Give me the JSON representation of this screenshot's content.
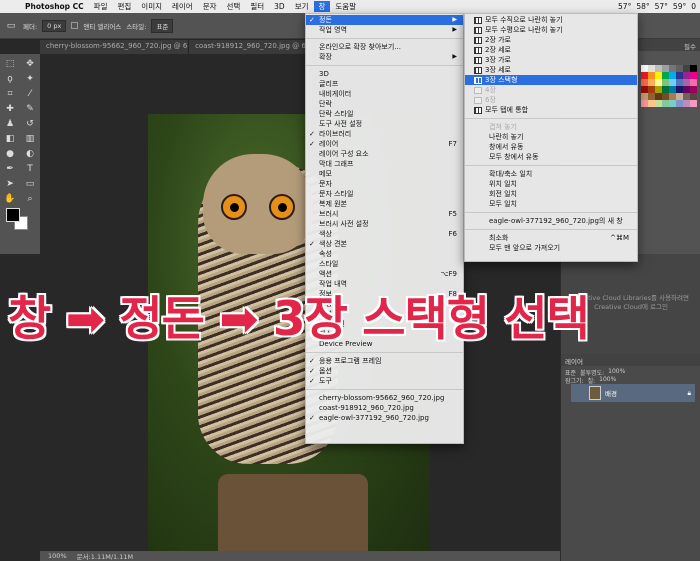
{
  "menubar": {
    "app": "Photoshop CC",
    "items": [
      "파일",
      "편집",
      "이미지",
      "레이어",
      "문자",
      "선택",
      "필터",
      "3D",
      "보기",
      "창",
      "도움말"
    ],
    "status": [
      "57°",
      "58°",
      "57°",
      "59°",
      "0"
    ]
  },
  "optbar": {
    "feather_label": "페더:",
    "feather_value": "0 px",
    "antialias": "앤티 앨리어스",
    "style_label": "스타일:",
    "style_value": "표준"
  },
  "tabs": [
    "cherry-blossom-95662_960_720.jpg @ 6...",
    "coast-918912_960_720.jpg @ 6..."
  ],
  "window_menu": {
    "items": [
      {
        "label": "정돈",
        "check": "✓",
        "submenu": true,
        "highlighted": true
      },
      {
        "label": "작업 영역",
        "submenu": true
      },
      {
        "sep": true
      },
      {
        "label": "온라인으로 확장 찾아보기..."
      },
      {
        "label": "확장",
        "submenu": true
      },
      {
        "sep": true
      },
      {
        "label": "3D"
      },
      {
        "label": "글리프"
      },
      {
        "label": "내비게이터"
      },
      {
        "label": "단락"
      },
      {
        "label": "단락 스타일"
      },
      {
        "label": "도구 사전 설정"
      },
      {
        "label": "라이브러리",
        "check": "✓"
      },
      {
        "label": "레이어",
        "check": "✓",
        "shortcut": "F7"
      },
      {
        "label": "레이어 구성 요소"
      },
      {
        "label": "막대 그래프"
      },
      {
        "label": "메모"
      },
      {
        "label": "문자"
      },
      {
        "label": "문자 스타일"
      },
      {
        "label": "복제 원본"
      },
      {
        "label": "브러시",
        "shortcut": "F5"
      },
      {
        "label": "브러시 사전 설정"
      },
      {
        "label": "색상",
        "shortcut": "F6"
      },
      {
        "label": "색상 견본",
        "check": "✓"
      },
      {
        "label": "속성"
      },
      {
        "label": "스타일"
      },
      {
        "label": "액션",
        "shortcut": "⌥F9"
      },
      {
        "label": "작업 내역"
      },
      {
        "label": "정보",
        "shortcut": "F8"
      },
      {
        "label": "조정"
      },
      {
        "label": "채널"
      },
      {
        "label": "타임라인"
      },
      {
        "label": "패스"
      },
      {
        "label": "Device Preview"
      },
      {
        "sep": true
      },
      {
        "label": "응용 프로그램 프레임",
        "check": "✓"
      },
      {
        "label": "옵션",
        "check": "✓"
      },
      {
        "label": "도구",
        "check": "✓"
      },
      {
        "sep": true
      },
      {
        "label": "cherry-blossom-95662_960_720.jpg"
      },
      {
        "label": "coast-918912_960_720.jpg"
      },
      {
        "label": "eagle-owl-377192_960_720.jpg",
        "check": "✓"
      }
    ]
  },
  "arrange_submenu": {
    "items": [
      {
        "label": "모두 수직으로 나란히 놓기",
        "icon": true
      },
      {
        "label": "모두 수평으로 나란히 놓기",
        "icon": true
      },
      {
        "label": "2장 가로",
        "icon": true
      },
      {
        "label": "2장 세로",
        "icon": true
      },
      {
        "label": "3장 가로",
        "icon": true
      },
      {
        "label": "3장 세로",
        "icon": true
      },
      {
        "label": "3장 스택형",
        "icon": true,
        "highlighted": true
      },
      {
        "label": "4장",
        "icon": true,
        "disabled": true
      },
      {
        "label": "6장",
        "icon": true,
        "disabled": true
      },
      {
        "label": "모두 탭에 통합",
        "icon": true
      },
      {
        "sep": true
      },
      {
        "label": "겹쳐 놓기",
        "disabled": true
      },
      {
        "label": "나란히 놓기"
      },
      {
        "label": "창에서 유동"
      },
      {
        "label": "모두 창에서 유동"
      },
      {
        "sep": true
      },
      {
        "label": "확대/축소 일치"
      },
      {
        "label": "위치 일치"
      },
      {
        "label": "회전 일치"
      },
      {
        "label": "모두 일치"
      },
      {
        "sep": true
      },
      {
        "label": "eagle-owl-377192_960_720.jpg의 새 창"
      },
      {
        "sep": true
      },
      {
        "label": "최소화",
        "shortcut": "^⌘M"
      },
      {
        "label": "모두 맨 앞으로 가져오기"
      }
    ]
  },
  "right_panel": {
    "essentials": "필수",
    "cc_libraries": "Creative Cloud Libraries를 사용하려면 Creative Cloud에 로그인",
    "layers_tab": "레이어",
    "blend_mode": "표준",
    "opacity_label": "불투명도:",
    "opacity_value": "100%",
    "fill_label": "칠:",
    "fill_value": "100%",
    "lock_label": "잠그기:",
    "layer_name": "배경"
  },
  "status": {
    "zoom": "100%",
    "doc": "문서:1.11M/1.11M"
  },
  "annotation": "창 ➡ 정돈 ➡ 3장 스택형 선택",
  "colors": {
    "menu_highlight": "#2a6ee0",
    "annotation": "#e2264a",
    "panel_bg": "#535353"
  }
}
